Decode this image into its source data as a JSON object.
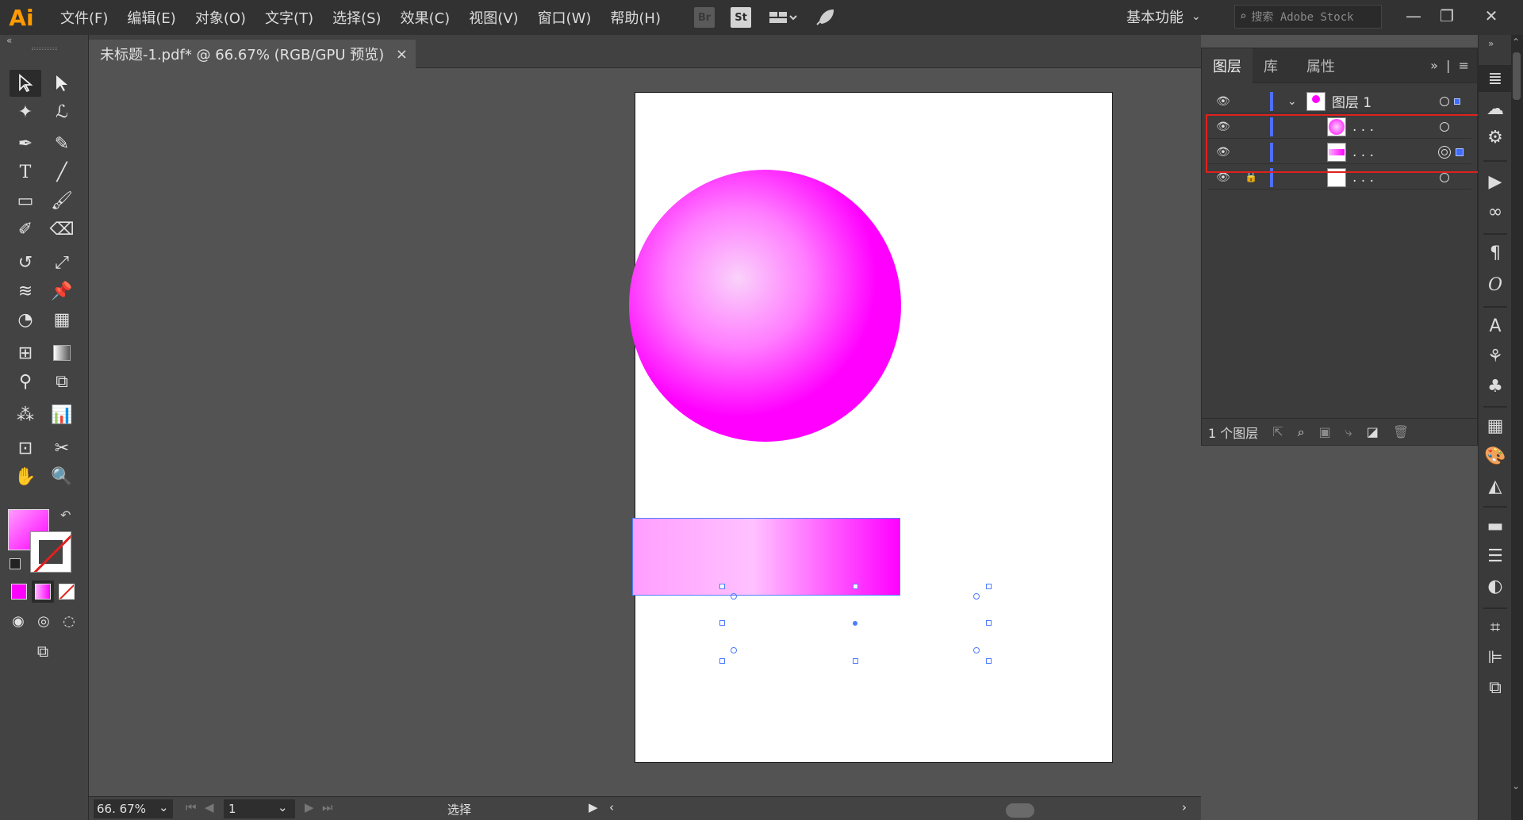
{
  "app": {
    "logo": "Ai"
  },
  "menu": [
    "文件(F)",
    "编辑(E)",
    "对象(O)",
    "文字(T)",
    "选择(S)",
    "效果(C)",
    "视图(V)",
    "窗口(W)",
    "帮助(H)"
  ],
  "bridge_label": "Br",
  "stock_label": "St",
  "workspace": {
    "label": "基本功能"
  },
  "search": {
    "placeholder": "搜索 Adobe Stock"
  },
  "document": {
    "tab_title": "未标题-1.pdf* @ 66.67% (RGB/GPU 预览)",
    "close_glyph": "×"
  },
  "status": {
    "zoom": "66. 67%",
    "page": "1",
    "tool_text": "选择"
  },
  "layers_panel": {
    "tabs": [
      "图层",
      "库",
      "属性"
    ],
    "rows": [
      {
        "name": "图层 1",
        "thumb": "layer"
      },
      {
        "name": ". . .",
        "thumb": "circle"
      },
      {
        "name": ". . .",
        "thumb": "rect"
      },
      {
        "name": ". . .",
        "thumb": "white"
      }
    ],
    "footer": "1 个图层"
  },
  "colors": {
    "fill_swatch": "#ff66ff",
    "accent": "#4f7cff",
    "magenta": "#ff00ff",
    "highlight": "#e0211d"
  },
  "tools": [
    "selection-tool",
    "direct-selection-tool",
    "magic-wand-tool",
    "lasso-tool",
    "pen-tool",
    "curvature-tool",
    "type-tool",
    "line-tool",
    "rectangle-tool",
    "paintbrush-tool",
    "shaper-tool",
    "eraser-tool",
    "rotate-tool",
    "scale-tool",
    "warp-tool",
    "puppet-warp-tool",
    "shape-builder-tool",
    "perspective-grid-tool",
    "mesh-tool",
    "gradient-tool",
    "eyedropper-tool",
    "blend-tool",
    "symbol-sprayer-tool",
    "column-graph-tool",
    "artboard-tool",
    "slice-tool",
    "hand-tool",
    "zoom-tool"
  ]
}
